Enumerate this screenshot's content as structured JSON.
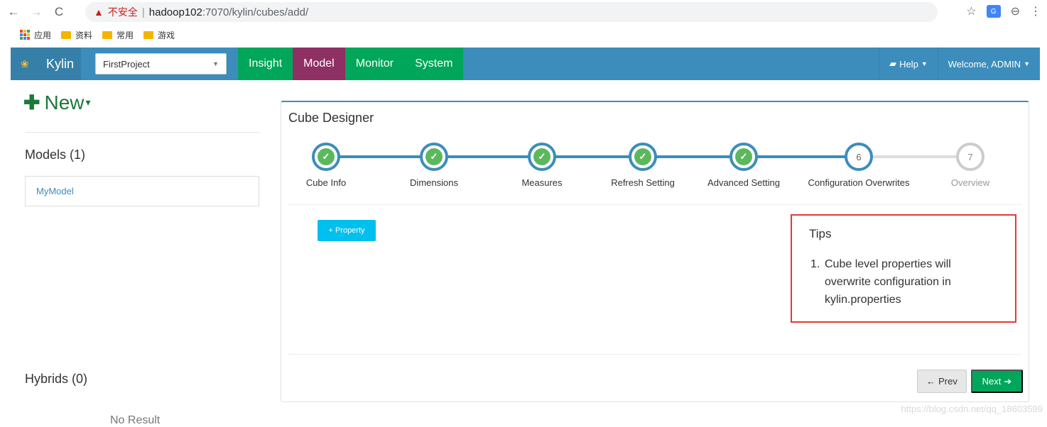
{
  "browser": {
    "back_icon": "←",
    "forward_icon": "→",
    "reload_icon": "C",
    "insecure_label": "不安全",
    "url_host": "hadoop102",
    "url_rest": ":7070/kylin/cubes/add/",
    "star_icon": "☆",
    "translate_icon_text": "G",
    "menu_icon": "⋮",
    "profile_icon": "⊖"
  },
  "bookmarks": {
    "apps": "应用",
    "items": [
      "资料",
      "常用",
      "游戏"
    ],
    "apps_icon_colors": [
      "#ea4335",
      "#fbbc05",
      "#34a853",
      "#4285f4",
      "#ea4335",
      "#fbbc05",
      "#34a853",
      "#4285f4",
      "#ea4335"
    ],
    "folder_color": "#f4b400"
  },
  "navbar": {
    "brand": "Kylin",
    "project": "FirstProject",
    "tabs": [
      "Insight",
      "Model",
      "Monitor",
      "System"
    ],
    "active_tab": "Model",
    "help": "Help",
    "welcome": "Welcome, ADMIN",
    "colors": {
      "bar": "#3c8dbc",
      "green": "#00a65a",
      "active": "#8e3064"
    }
  },
  "sidebar": {
    "new_label": "New",
    "models_title": "Models (1)",
    "models": [
      "MyModel"
    ],
    "hybrids_title": "Hybrids (0)",
    "no_result": "No Result"
  },
  "designer": {
    "title": "Cube Designer",
    "steps": [
      {
        "label": "Cube Info",
        "state": "done"
      },
      {
        "label": "Dimensions",
        "state": "done"
      },
      {
        "label": "Measures",
        "state": "done"
      },
      {
        "label": "Refresh Setting",
        "state": "done"
      },
      {
        "label": "Advanced Setting",
        "state": "done"
      },
      {
        "label": "Configuration Overwrites",
        "state": "current",
        "number": "6"
      },
      {
        "label": "Overview",
        "state": "future",
        "number": "7"
      }
    ],
    "property_button": "+ Property",
    "tips_title": "Tips",
    "tips_number": "1.",
    "tips_text": "Cube level properties will overwrite configuration in kylin.properties",
    "prev_button": "Prev",
    "next_button": "Next"
  },
  "watermark": "https://blog.csdn.net/qq_18603599"
}
